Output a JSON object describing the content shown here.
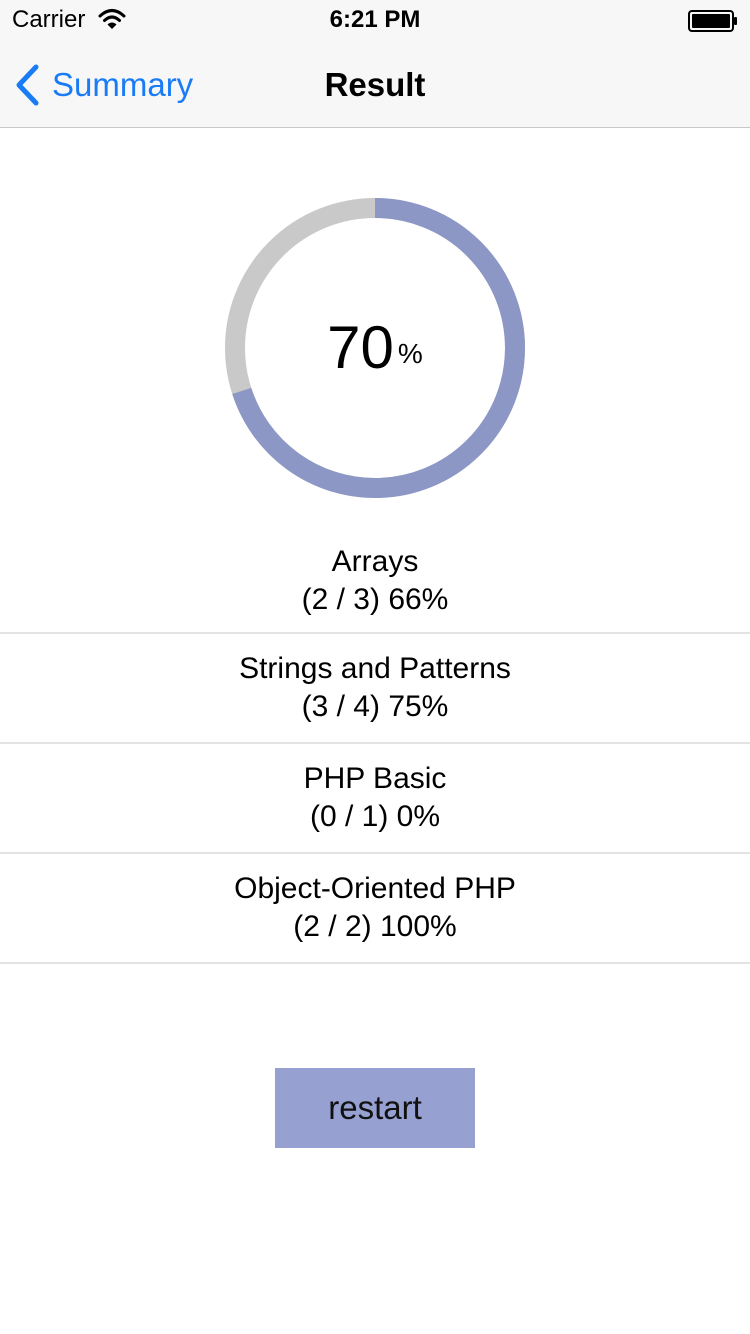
{
  "status_bar": {
    "carrier": "Carrier",
    "time": "6:21 PM"
  },
  "nav": {
    "back_label": "Summary",
    "title": "Result"
  },
  "result": {
    "percent": 70,
    "percent_text": "70",
    "unit": "%",
    "ring_color": "#8c97c6",
    "track_color": "#c9c9c9"
  },
  "categories": [
    {
      "name": "Arrays",
      "score": "(2 / 3) 66%"
    },
    {
      "name": "Strings and Patterns",
      "score": "(3 / 4) 75%"
    },
    {
      "name": "PHP Basic",
      "score": "(0 / 1) 0%"
    },
    {
      "name": "Object-Oriented PHP",
      "score": "(2 / 2) 100%"
    }
  ],
  "restart": {
    "label": "restart",
    "color": "#96a0d1"
  }
}
